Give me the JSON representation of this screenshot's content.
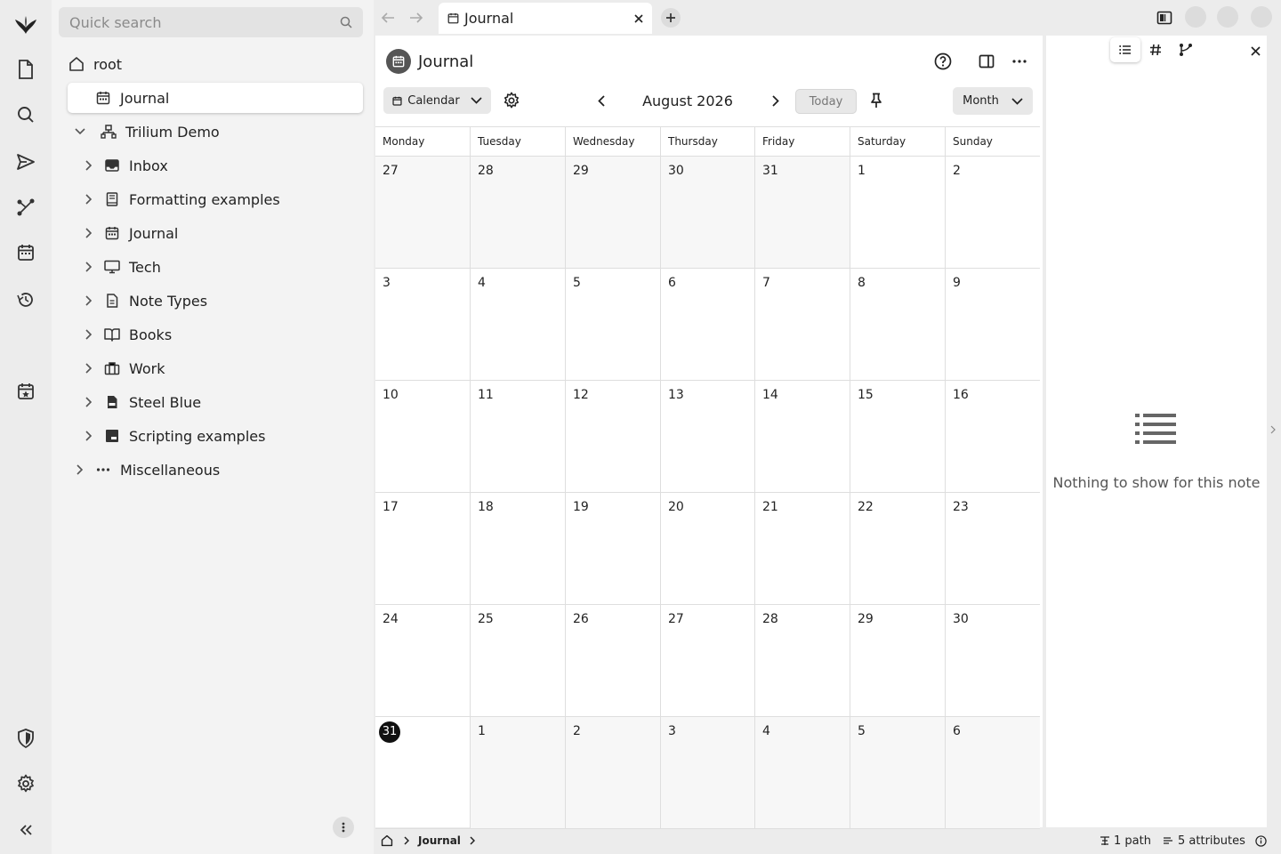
{
  "search": {
    "placeholder": "Quick search"
  },
  "tree": {
    "root_label": "root",
    "items": [
      {
        "label": "Journal",
        "icon": "calendar-icon"
      },
      {
        "label": "Trilium Demo",
        "icon": "sitemap-icon"
      },
      {
        "label": "Inbox",
        "icon": "inbox-icon"
      },
      {
        "label": "Formatting examples",
        "icon": "book-icon"
      },
      {
        "label": "Journal",
        "icon": "calendar-icon"
      },
      {
        "label": "Tech",
        "icon": "monitor-icon"
      },
      {
        "label": "Note Types",
        "icon": "file-icon"
      },
      {
        "label": "Books",
        "icon": "open-book-icon"
      },
      {
        "label": "Work",
        "icon": "briefcase-icon"
      },
      {
        "label": "Steel Blue",
        "icon": "css-file-icon"
      },
      {
        "label": "Scripting examples",
        "icon": "js-file-icon"
      },
      {
        "label": "Miscellaneous",
        "icon": "dots-icon"
      }
    ]
  },
  "tab": {
    "label": "Journal"
  },
  "note": {
    "title": "Journal"
  },
  "calendar": {
    "view_label": "Calendar",
    "month_label": "August 2026",
    "today_label": "Today",
    "range_label": "Month",
    "weekdays": [
      "Monday",
      "Tuesday",
      "Wednesday",
      "Thursday",
      "Friday",
      "Saturday",
      "Sunday"
    ],
    "weeks": [
      [
        "27",
        "28",
        "29",
        "30",
        "31",
        "1",
        "2"
      ],
      [
        "3",
        "4",
        "5",
        "6",
        "7",
        "8",
        "9"
      ],
      [
        "10",
        "11",
        "12",
        "13",
        "14",
        "15",
        "16"
      ],
      [
        "17",
        "18",
        "19",
        "20",
        "21",
        "22",
        "23"
      ],
      [
        "24",
        "25",
        "26",
        "27",
        "28",
        "29",
        "30"
      ],
      [
        "31",
        "1",
        "2",
        "3",
        "4",
        "5",
        "6"
      ]
    ]
  },
  "right_panel": {
    "empty_text": "Nothing to show for this note"
  },
  "status": {
    "breadcrumb": "Journal",
    "paths": "1 path",
    "attributes": "5 attributes"
  },
  "colors": {
    "today_badge": "#111111",
    "active_item_bg": "#ffffff",
    "panel_bg": "#f3f3f3"
  }
}
